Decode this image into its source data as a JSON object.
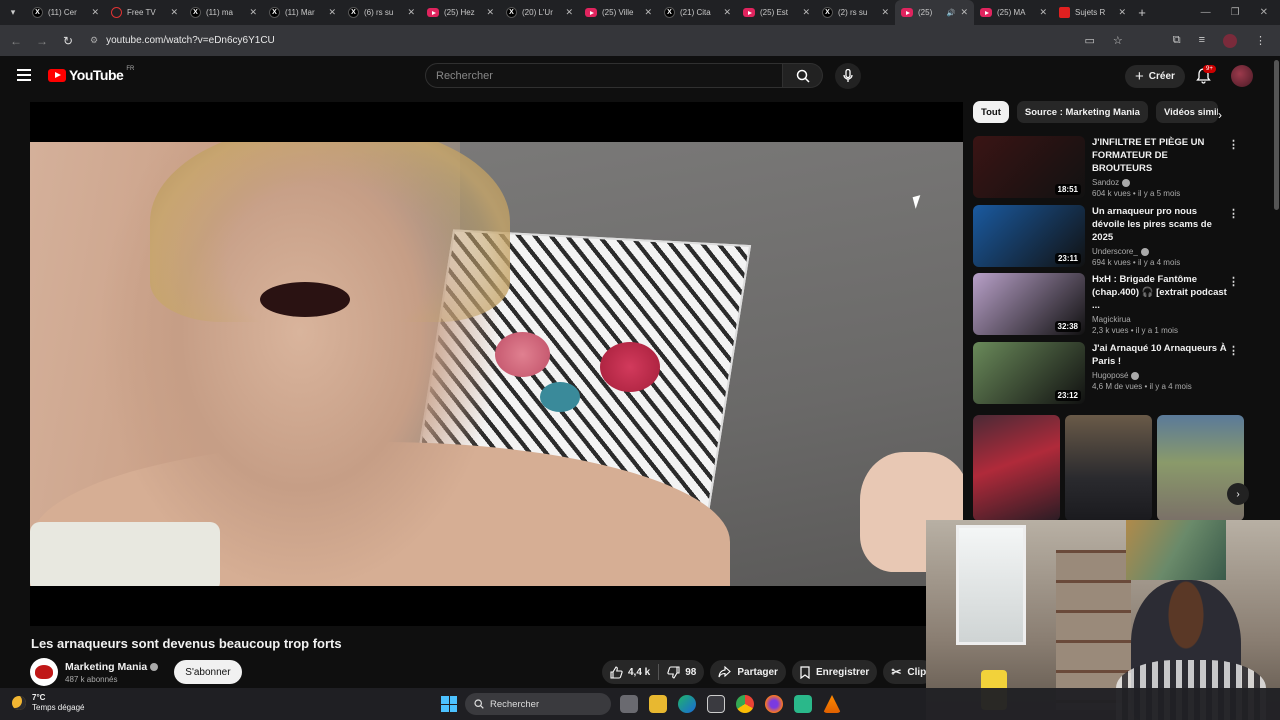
{
  "browser": {
    "tabs": [
      {
        "title": "(11) Cer",
        "icon": "x",
        "active": false
      },
      {
        "title": "Free TV",
        "icon": "ring",
        "active": false
      },
      {
        "title": "(11) ma",
        "icon": "x",
        "active": false
      },
      {
        "title": "(11) Mar",
        "icon": "x",
        "active": false
      },
      {
        "title": "(6) rs su",
        "icon": "x",
        "active": false
      },
      {
        "title": "(25) Hez",
        "icon": "yt",
        "active": false
      },
      {
        "title": "(20) L'Ur",
        "icon": "x",
        "active": false
      },
      {
        "title": "(25) Ville",
        "icon": "yt",
        "active": false
      },
      {
        "title": "(21) Cita",
        "icon": "x",
        "active": false
      },
      {
        "title": "(25) Est",
        "icon": "yt",
        "active": false
      },
      {
        "title": "(2) rs su",
        "icon": "x",
        "active": false
      },
      {
        "title": "(25)",
        "icon": "yt",
        "active": true
      },
      {
        "title": "(25) MA",
        "icon": "yt",
        "active": false
      },
      {
        "title": "Sujets R",
        "icon": "red",
        "active": false
      }
    ],
    "url": "youtube.com/watch?v=eDn6cy6Y1CU"
  },
  "header": {
    "logo_text": "YouTube",
    "country": "FR",
    "search_placeholder": "Rechercher",
    "create_label": "Créer",
    "notif_count": "9+"
  },
  "video": {
    "title": "Les arnaqueurs sont devenus beaucoup trop forts",
    "channel": "Marketing Mania",
    "subscribers": "487 k abonnés",
    "subscribe_label": "S'abonner",
    "likes": "4,4 k",
    "dislikes": "98",
    "share_label": "Partager",
    "save_label": "Enregistrer",
    "clip_label": "Clip"
  },
  "sidebar": {
    "chips": [
      "Tout",
      "Source : Marketing Mania",
      "Vidéos simila"
    ],
    "recommendations": [
      {
        "title": "J'INFILTRE ET PIÈGE UN FORMATEUR DE BROUTEURS",
        "channel": "Sandoz",
        "verified": true,
        "views": "604 k vues",
        "age": "il y a 5 mois",
        "duration": "18:51",
        "thumb_color": "#3a1414"
      },
      {
        "title": "Un arnaqueur pro nous dévoile les pires scams de 2025",
        "channel": "Underscore_",
        "verified": true,
        "views": "694 k vues",
        "age": "il y a 4 mois",
        "duration": "23:11",
        "thumb_color": "#1a5aa0"
      },
      {
        "title": "HxH : Brigade Fantôme (chap.400) 🎧 [extrait podcast ...",
        "channel": "Magickirua",
        "verified": false,
        "views": "2,3 k vues",
        "age": "il y a 1 mois",
        "duration": "32:38",
        "thumb_color": "#b8a0c8"
      },
      {
        "title": "J'ai Arnaqué 10 Arnaqueurs À Paris !",
        "channel": "Hugoposé",
        "verified": true,
        "views": "4,6 M de vues",
        "age": "il y a 4 mois",
        "duration": "23:12",
        "thumb_color": "#6a8a5a"
      }
    ]
  },
  "taskbar": {
    "temperature": "7°C",
    "weather": "Temps dégagé",
    "search_label": "Rechercher"
  }
}
